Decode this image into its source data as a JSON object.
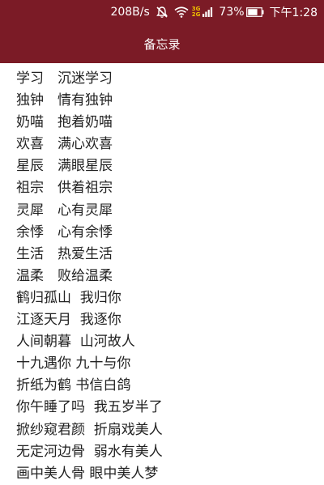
{
  "status_bar": {
    "net_speed": "208B/s",
    "network_top": "3G",
    "network_bottom": "2G",
    "battery_percent": "73%",
    "time": "下午1:28",
    "icons": [
      "mute-icon",
      "wifi-icon",
      "signal-icon",
      "battery-icon"
    ],
    "colors": {
      "bar": "#7b1b26",
      "text": "#ffffff",
      "network_badge": "#f0c000"
    }
  },
  "app_bar": {
    "title": "备忘录"
  },
  "notes": [
    "学习　沉迷学习",
    "独钟　情有独钟",
    "奶喵　抱着奶喵",
    "欢喜　满心欢喜",
    "星辰　满眼星辰",
    "祖宗　供着祖宗",
    "灵犀　心有灵犀",
    "余悸　心有余悸",
    "生活　热爱生活",
    "温柔　败给温柔",
    "鹤归孤山  我归你",
    "江逐天月  我逐你",
    "人间朝暮  山河故人",
    "十九遇你 九十与你",
    "折纸为鹤 书信白鸽",
    "你午睡了吗  我五岁半了",
    "掀纱窥君颜  折扇戏美人",
    "无定河边骨  弱水有美人",
    "画中美人骨 眼中美人梦"
  ]
}
